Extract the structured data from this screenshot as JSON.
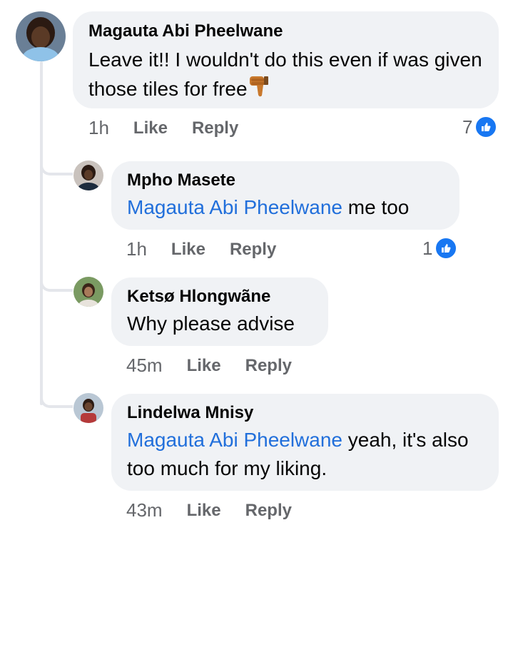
{
  "colors": {
    "bubble_bg": "#f0f2f5",
    "mention": "#216fdb",
    "meta_text": "#65676b",
    "like_blue": "#1877f2"
  },
  "comments": [
    {
      "author": "Magauta Abi Pheelwane",
      "mention": "",
      "text": "Leave it!! I wouldn't do this even if was given those tiles for free",
      "emoji": "thumbs-down-emoji",
      "time": "1h",
      "like_label": "Like",
      "reply_label": "Reply",
      "reactions": "7"
    },
    {
      "author": "Mpho Masete",
      "mention": "Magauta Abi Pheelwane",
      "text": " me too",
      "time": "1h",
      "like_label": "Like",
      "reply_label": "Reply",
      "reactions": "1"
    },
    {
      "author": "Ketsø Hlongwãne",
      "mention": "",
      "text": "Why please advise",
      "time": "45m",
      "like_label": "Like",
      "reply_label": "Reply",
      "reactions": ""
    },
    {
      "author": "Lindelwa Mnisy",
      "mention": "Magauta Abi Pheelwane",
      "text": " yeah, it's also too much for my liking.",
      "time": "43m",
      "like_label": "Like",
      "reply_label": "Reply",
      "reactions": ""
    }
  ]
}
